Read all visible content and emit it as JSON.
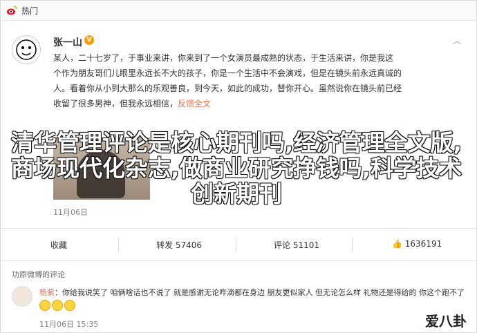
{
  "header": {
    "topic": "热门"
  },
  "post": {
    "username": "张一山",
    "verified": true,
    "text_lines": [
      "某人，二十七岁了，于事业来讲，你来到了一个女演员最成熟的状态，于生活来讲，你是我这",
      "个作为朋友哥们儿眼里永远长不大的孩子，你是一个生活中不会演戏，但是在镜头前永远真诚的",
      "人。看着你从小到大那么的乐观善良，到今天，如此的成功，替你开心。虽然说你在镜头前已经",
      "收留了很多男神，但我永远相信，"
    ],
    "translate_label": "反馈全文",
    "time": "11月06日",
    "overlay_title": "清华管理评论是核心期刊吗,经济管理全文版,商场现代化杂志,做商业研究挣钱吗,科学技术创新期刊"
  },
  "actions": {
    "fav": "收藏",
    "share": "转发 57406",
    "comment": "评论 51101",
    "like": "1636191"
  },
  "comments": {
    "header": "功原微博的评论",
    "items": [
      {
        "user": "杨紫",
        "text": "：你给我说笑了 咱俩啥话也不说了 就是感谢无论咋滴都在身边 朋友更似家人 但无论怎么样 礼物还是得给的 你这个跑不了",
        "time": "11月06日 15:35"
      }
    ]
  },
  "watermark": "爱八卦",
  "colors": {
    "accent": "#eb7350",
    "badge": "#ff9a00"
  }
}
